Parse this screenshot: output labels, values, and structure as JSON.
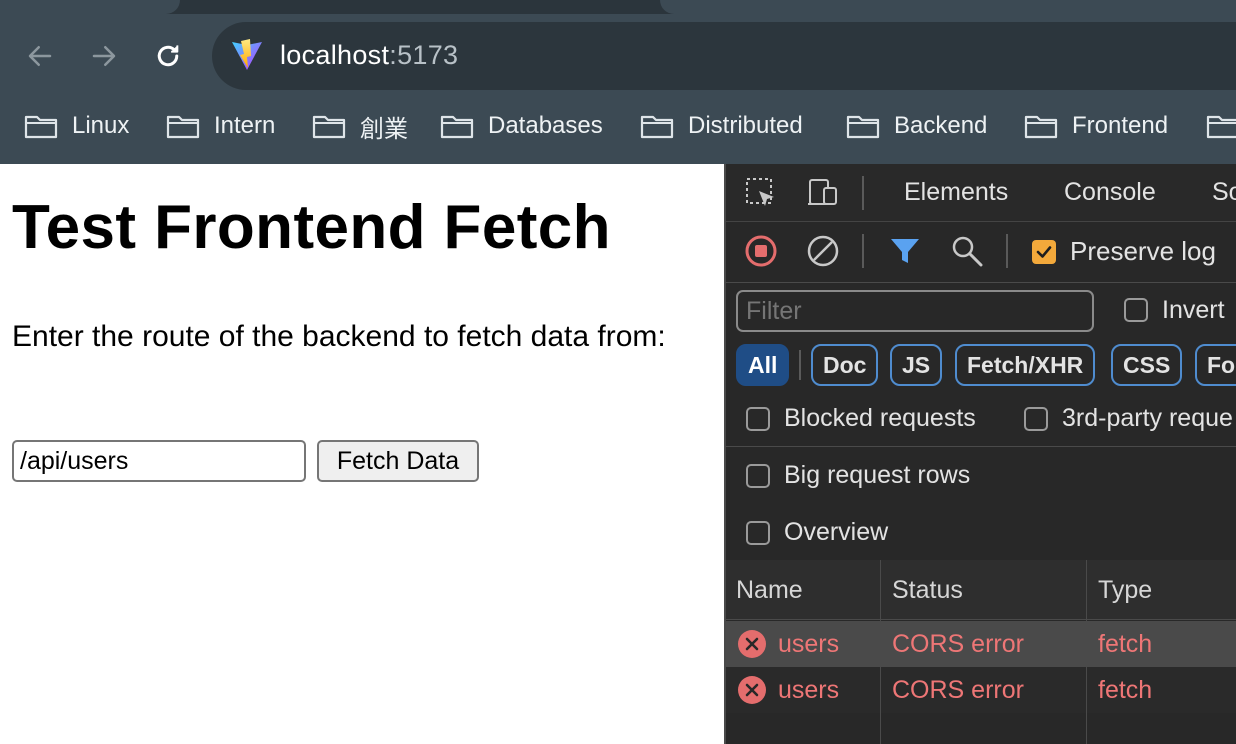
{
  "browser": {
    "url_host": "localhost",
    "url_port": ":5173",
    "bookmarks": [
      "Linux",
      "Intern",
      "創業",
      "Databases",
      "Distributed",
      "Backend",
      "Frontend"
    ]
  },
  "page": {
    "title": "Test Frontend Fetch",
    "description": "Enter the route of the backend to fetch data from:",
    "route_value": "/api/users",
    "fetch_button": "Fetch Data"
  },
  "devtools": {
    "tabs": [
      "Elements",
      "Console",
      "So"
    ],
    "preserve_log": "Preserve log",
    "filter_placeholder": "Filter",
    "invert": "Invert",
    "chips": [
      "All",
      "Doc",
      "JS",
      "Fetch/XHR",
      "CSS",
      "Fo"
    ],
    "blocked_requests": "Blocked requests",
    "third_party": "3rd-party reque",
    "big_request_rows": "Big request rows",
    "overview": "Overview",
    "columns": [
      "Name",
      "Status",
      "Type"
    ],
    "rows": [
      {
        "name": "users",
        "status": "CORS error",
        "type": "fetch"
      },
      {
        "name": "users",
        "status": "CORS error",
        "type": "fetch"
      }
    ],
    "colors": {
      "error": "#ee7676",
      "accent_chip": "#1f4d86",
      "checkbox_checked": "#f3a93b"
    }
  }
}
